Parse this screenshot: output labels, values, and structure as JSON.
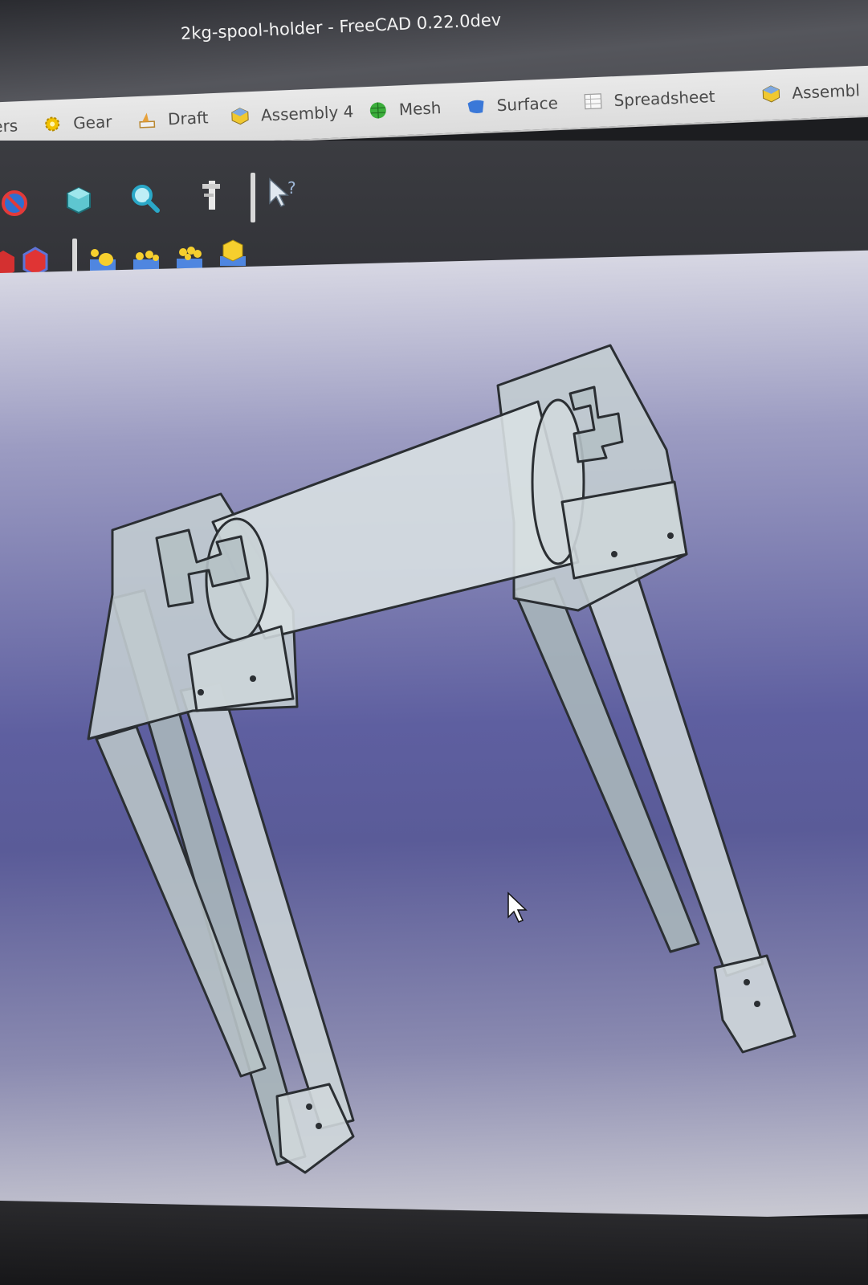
{
  "window": {
    "title": "2kg-spool-holder - FreeCAD 0.22.0dev"
  },
  "workbench_tabs": [
    {
      "label": "ers",
      "icon": "partial-icon"
    },
    {
      "label": "Gear",
      "icon": "gear-icon"
    },
    {
      "label": "Draft",
      "icon": "draft-icon"
    },
    {
      "label": "Assembly 4",
      "icon": "assembly4-icon"
    },
    {
      "label": "Mesh",
      "icon": "mesh-icon"
    },
    {
      "label": "Surface",
      "icon": "surface-icon"
    },
    {
      "label": "Spreadsheet",
      "icon": "spreadsheet-icon"
    },
    {
      "label": "Assembl",
      "icon": "assembly-icon"
    }
  ],
  "toolbar_row1": [
    {
      "name": "no-entry-icon"
    },
    {
      "name": "view-box-icon"
    },
    {
      "name": "zoom-icon"
    },
    {
      "name": "measure-icon"
    },
    {
      "name": "whats-this-icon"
    }
  ],
  "toolbar_row2": [
    {
      "name": "red-cube-icon"
    },
    {
      "name": "red-shape-icon"
    },
    {
      "name": "assembly-part-icon"
    },
    {
      "name": "assembly-link-icon"
    },
    {
      "name": "assembly-variant-icon"
    },
    {
      "name": "assembly-fasteners-icon"
    }
  ],
  "colors": {
    "tab_bg": "#e4e4e4",
    "toolbar_bg": "#36373c",
    "viewport_top": "#d7d7e3",
    "viewport_mid": "#5e5fa0",
    "model_fill": "#c8d2d4",
    "model_edge": "#2b2f33"
  }
}
